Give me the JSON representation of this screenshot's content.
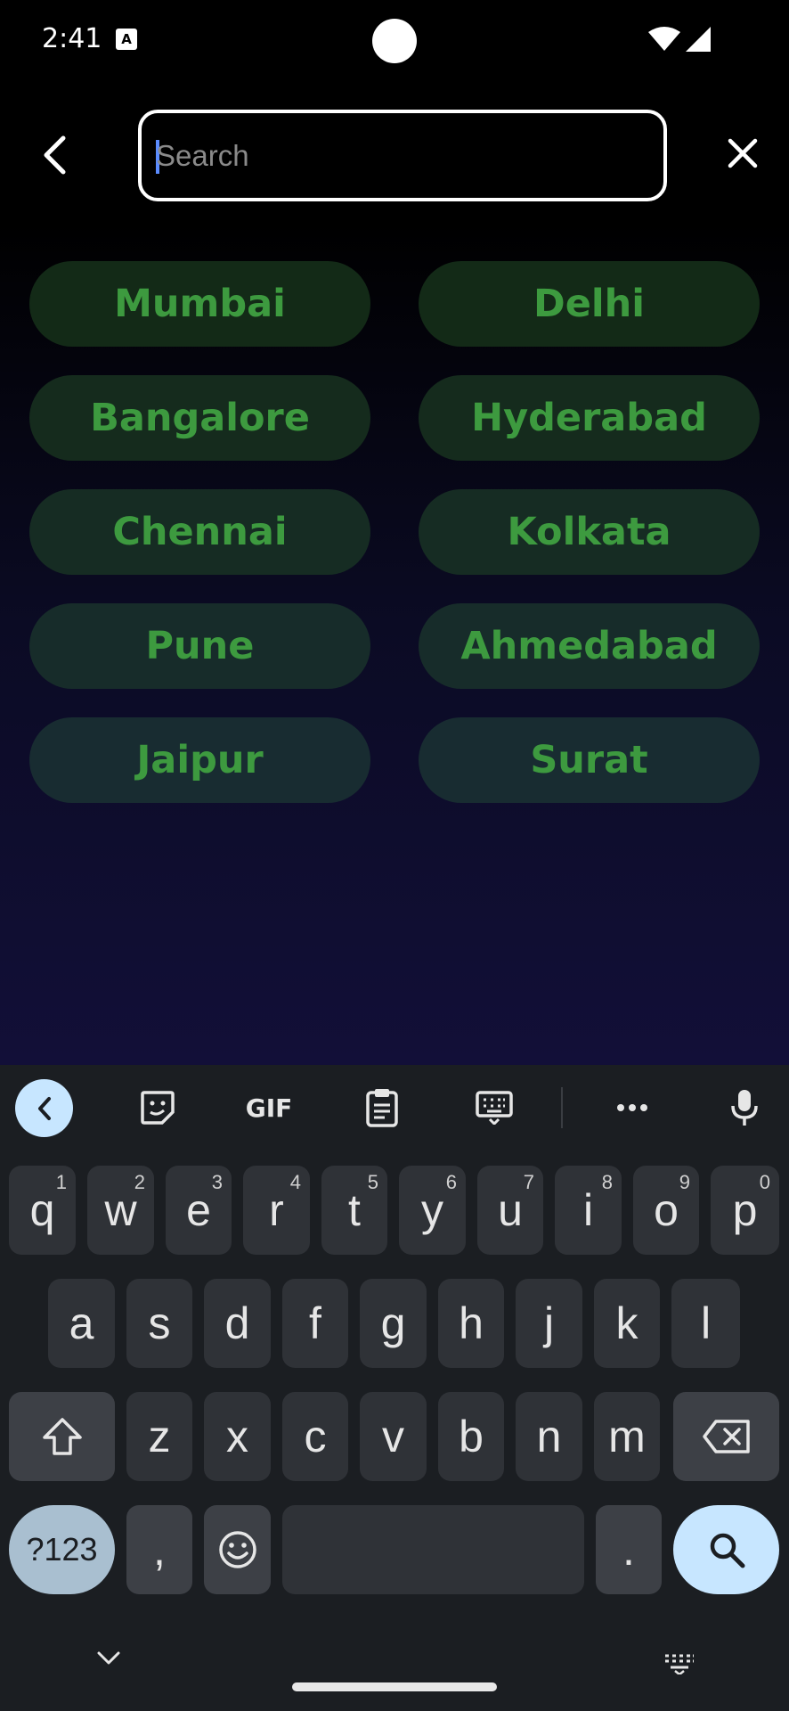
{
  "status_bar": {
    "time": "2:41",
    "notification_glyph": "A",
    "icons": [
      "wifi-icon",
      "cell-signal-icon"
    ]
  },
  "search": {
    "placeholder": "Search",
    "value": "",
    "back_icon": "chevron-left-icon",
    "clear_icon": "close-icon"
  },
  "cities": [
    {
      "label": "Mumbai"
    },
    {
      "label": "Delhi"
    },
    {
      "label": "Bangalore"
    },
    {
      "label": "Hyderabad"
    },
    {
      "label": "Chennai"
    },
    {
      "label": "Kolkata"
    },
    {
      "label": "Pune"
    },
    {
      "label": "Ahmedabad"
    },
    {
      "label": "Jaipur"
    },
    {
      "label": "Surat"
    }
  ],
  "keyboard": {
    "toolbar": {
      "gif_label": "GIF"
    },
    "row1": [
      {
        "k": "q",
        "h": "1"
      },
      {
        "k": "w",
        "h": "2"
      },
      {
        "k": "e",
        "h": "3"
      },
      {
        "k": "r",
        "h": "4"
      },
      {
        "k": "t",
        "h": "5"
      },
      {
        "k": "y",
        "h": "6"
      },
      {
        "k": "u",
        "h": "7"
      },
      {
        "k": "i",
        "h": "8"
      },
      {
        "k": "o",
        "h": "9"
      },
      {
        "k": "p",
        "h": "0"
      }
    ],
    "row2": [
      "a",
      "s",
      "d",
      "f",
      "g",
      "h",
      "j",
      "k",
      "l"
    ],
    "row3": [
      "z",
      "x",
      "c",
      "v",
      "b",
      "n",
      "m"
    ],
    "symbols_label": "?123",
    "comma": ",",
    "period": "."
  },
  "colors": {
    "chip_text": "#3d9a3f",
    "accent_blue": "#c7e6ff",
    "keyboard_bg": "#1b1e22"
  }
}
